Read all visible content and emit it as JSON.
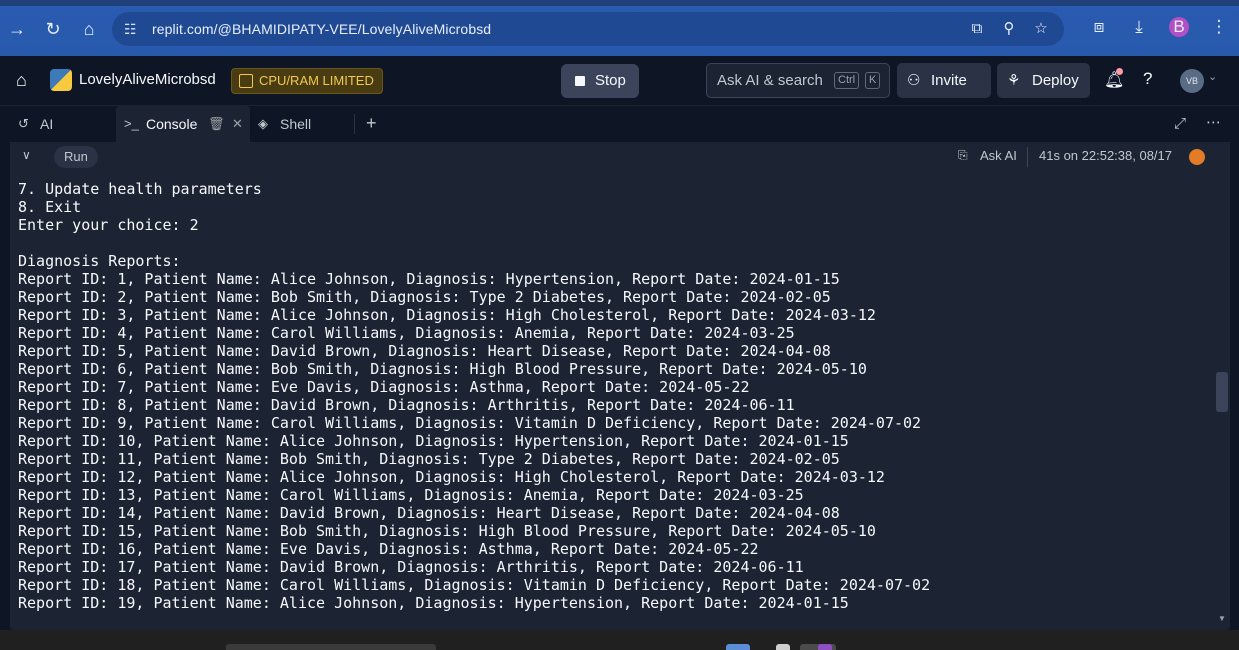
{
  "browser": {
    "url": "replit.com/@BHAMIDIPATY-VEE/LovelyAliveMicrobsd",
    "profile_initial": "B"
  },
  "app": {
    "repl_name": "LovelyAliveMicrobsd",
    "resource_badge": "CPU/RAM LIMITED",
    "stop_label": "Stop",
    "search_placeholder": "Ask AI & search",
    "search_kbd_1": "Ctrl",
    "search_kbd_2": "K",
    "invite_label": "Invite",
    "deploy_label": "Deploy",
    "avatar_initials": "VB",
    "help_label": "?"
  },
  "tabs": [
    {
      "label": "AI"
    },
    {
      "label": "Console"
    },
    {
      "label": "Shell"
    }
  ],
  "console": {
    "run_label": "Run",
    "ask_ai_label": "Ask AI",
    "timing": "41s on 22:52:38, 08/17",
    "lines": [
      "7. Update health parameters",
      "8. Exit",
      "Enter your choice: 2",
      "",
      "Diagnosis Reports:",
      "Report ID: 1, Patient Name: Alice Johnson, Diagnosis: Hypertension, Report Date: 2024-01-15",
      "Report ID: 2, Patient Name: Bob Smith, Diagnosis: Type 2 Diabetes, Report Date: 2024-02-05",
      "Report ID: 3, Patient Name: Alice Johnson, Diagnosis: High Cholesterol, Report Date: 2024-03-12",
      "Report ID: 4, Patient Name: Carol Williams, Diagnosis: Anemia, Report Date: 2024-03-25",
      "Report ID: 5, Patient Name: David Brown, Diagnosis: Heart Disease, Report Date: 2024-04-08",
      "Report ID: 6, Patient Name: Bob Smith, Diagnosis: High Blood Pressure, Report Date: 2024-05-10",
      "Report ID: 7, Patient Name: Eve Davis, Diagnosis: Asthma, Report Date: 2024-05-22",
      "Report ID: 8, Patient Name: David Brown, Diagnosis: Arthritis, Report Date: 2024-06-11",
      "Report ID: 9, Patient Name: Carol Williams, Diagnosis: Vitamin D Deficiency, Report Date: 2024-07-02",
      "Report ID: 10, Patient Name: Alice Johnson, Diagnosis: Hypertension, Report Date: 2024-01-15",
      "Report ID: 11, Patient Name: Bob Smith, Diagnosis: Type 2 Diabetes, Report Date: 2024-02-05",
      "Report ID: 12, Patient Name: Alice Johnson, Diagnosis: High Cholesterol, Report Date: 2024-03-12",
      "Report ID: 13, Patient Name: Carol Williams, Diagnosis: Anemia, Report Date: 2024-03-25",
      "Report ID: 14, Patient Name: David Brown, Diagnosis: Heart Disease, Report Date: 2024-04-08",
      "Report ID: 15, Patient Name: Bob Smith, Diagnosis: High Blood Pressure, Report Date: 2024-05-10",
      "Report ID: 16, Patient Name: Eve Davis, Diagnosis: Asthma, Report Date: 2024-05-22",
      "Report ID: 17, Patient Name: David Brown, Diagnosis: Arthritis, Report Date: 2024-06-11",
      "Report ID: 18, Patient Name: Carol Williams, Diagnosis: Vitamin D Deficiency, Report Date: 2024-07-02",
      "Report ID: 19, Patient Name: Alice Johnson, Diagnosis: Hypertension, Report Date: 2024-01-15"
    ]
  },
  "colors": {
    "browser_accent": "#2759ad",
    "badge_text": "#f2c94c",
    "status_dot": "#e37b28",
    "background": "#1c2333"
  },
  "icons": {
    "forward": "forward-arrow-icon",
    "reload": "reload-icon",
    "home": "home-icon",
    "python": "python-logo-icon"
  }
}
